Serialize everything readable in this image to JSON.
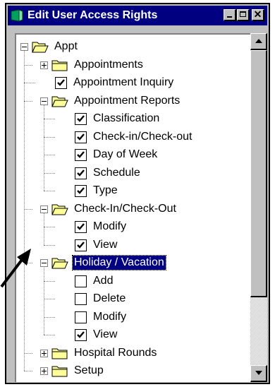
{
  "window": {
    "title": "Edit User Access Rights"
  },
  "title_buttons": [
    "minimize",
    "maximize",
    "close"
  ],
  "tree": [
    {
      "label": "Appt",
      "kind": "folder",
      "expander": "minus"
    },
    {
      "label": "Appointments",
      "kind": "folder",
      "expander": "plus"
    },
    {
      "label": "Appointment Inquiry",
      "kind": "checkbox",
      "checked": true
    },
    {
      "label": "Appointment Reports",
      "kind": "folder",
      "expander": "minus"
    },
    {
      "label": "Classification",
      "kind": "checkbox",
      "checked": true
    },
    {
      "label": "Check-in/Check-out",
      "kind": "checkbox",
      "checked": true
    },
    {
      "label": "Day of Week",
      "kind": "checkbox",
      "checked": true
    },
    {
      "label": "Schedule",
      "kind": "checkbox",
      "checked": true
    },
    {
      "label": "Type",
      "kind": "checkbox",
      "checked": true
    },
    {
      "label": "Check-In/Check-Out",
      "kind": "folder",
      "expander": "minus"
    },
    {
      "label": "Modify",
      "kind": "checkbox",
      "checked": true
    },
    {
      "label": "View",
      "kind": "checkbox",
      "checked": true
    },
    {
      "label": "Holiday / Vacation",
      "kind": "folder",
      "expander": "minus",
      "selected": true
    },
    {
      "label": "Add",
      "kind": "checkbox",
      "checked": false
    },
    {
      "label": "Delete",
      "kind": "checkbox",
      "checked": false
    },
    {
      "label": "Modify",
      "kind": "checkbox",
      "checked": false
    },
    {
      "label": "View",
      "kind": "checkbox",
      "checked": true
    },
    {
      "label": "Hospital Rounds",
      "kind": "folder",
      "expander": "plus"
    },
    {
      "label": "Setup",
      "kind": "folder",
      "expander": "plus"
    }
  ],
  "colors": {
    "titlebar": "#000080",
    "selection": "#000080",
    "face": "#c0c0c0",
    "folder": "#ffff99"
  }
}
